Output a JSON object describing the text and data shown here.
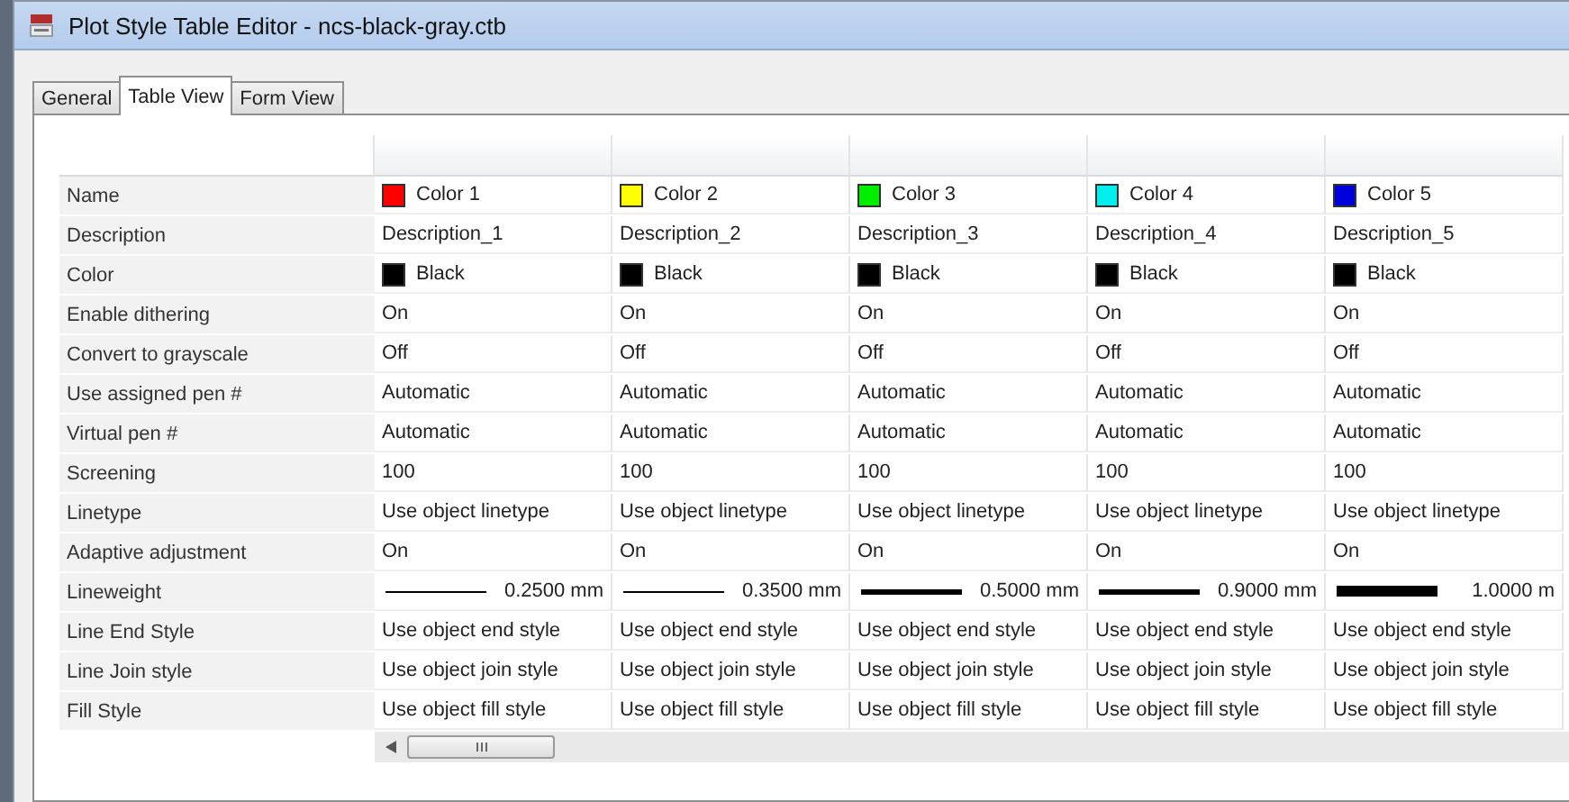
{
  "window": {
    "title": "Plot Style Table Editor - ncs-black-gray.ctb"
  },
  "tabs": [
    {
      "label": "General",
      "selected": false
    },
    {
      "label": "Table View",
      "selected": true
    },
    {
      "label": "Form View",
      "selected": false
    }
  ],
  "table": {
    "rows": [
      {
        "label": "Name",
        "cells": [
          {
            "kind": "swatch",
            "color": "#ff0000",
            "text": "Color 1"
          },
          {
            "kind": "swatch",
            "color": "#ffff00",
            "text": "Color 2"
          },
          {
            "kind": "swatch",
            "color": "#00ee00",
            "text": "Color 3"
          },
          {
            "kind": "swatch",
            "color": "#00eeee",
            "text": "Color 4"
          },
          {
            "kind": "swatch",
            "color": "#0000dd",
            "text": "Color 5"
          }
        ]
      },
      {
        "label": "Description",
        "cells": [
          {
            "kind": "text",
            "text": "Description_1"
          },
          {
            "kind": "text",
            "text": "Description_2"
          },
          {
            "kind": "text",
            "text": "Description_3"
          },
          {
            "kind": "text",
            "text": "Description_4"
          },
          {
            "kind": "text",
            "text": "Description_5"
          }
        ]
      },
      {
        "label": "Color",
        "cells": [
          {
            "kind": "swatch",
            "color": "#000000",
            "text": "Black"
          },
          {
            "kind": "swatch",
            "color": "#000000",
            "text": "Black"
          },
          {
            "kind": "swatch",
            "color": "#000000",
            "text": "Black"
          },
          {
            "kind": "swatch",
            "color": "#000000",
            "text": "Black"
          },
          {
            "kind": "swatch",
            "color": "#000000",
            "text": "Black"
          }
        ]
      },
      {
        "label": "Enable dithering",
        "cells": [
          {
            "kind": "text",
            "text": "On"
          },
          {
            "kind": "text",
            "text": "On"
          },
          {
            "kind": "text",
            "text": "On"
          },
          {
            "kind": "text",
            "text": "On"
          },
          {
            "kind": "text",
            "text": "On"
          }
        ]
      },
      {
        "label": "Convert to grayscale",
        "cells": [
          {
            "kind": "text",
            "text": "Off"
          },
          {
            "kind": "text",
            "text": "Off"
          },
          {
            "kind": "text",
            "text": "Off"
          },
          {
            "kind": "text",
            "text": "Off"
          },
          {
            "kind": "text",
            "text": "Off"
          }
        ]
      },
      {
        "label": "Use assigned pen #",
        "cells": [
          {
            "kind": "text",
            "text": "Automatic"
          },
          {
            "kind": "text",
            "text": "Automatic"
          },
          {
            "kind": "text",
            "text": "Automatic"
          },
          {
            "kind": "text",
            "text": "Automatic"
          },
          {
            "kind": "text",
            "text": "Automatic"
          }
        ]
      },
      {
        "label": "Virtual pen #",
        "cells": [
          {
            "kind": "text",
            "text": "Automatic"
          },
          {
            "kind": "text",
            "text": "Automatic"
          },
          {
            "kind": "text",
            "text": "Automatic"
          },
          {
            "kind": "text",
            "text": "Automatic"
          },
          {
            "kind": "text",
            "text": "Automatic"
          }
        ]
      },
      {
        "label": "Screening",
        "cells": [
          {
            "kind": "text",
            "text": "100"
          },
          {
            "kind": "text",
            "text": "100"
          },
          {
            "kind": "text",
            "text": "100"
          },
          {
            "kind": "text",
            "text": "100"
          },
          {
            "kind": "text",
            "text": "100"
          }
        ]
      },
      {
        "label": "Linetype",
        "cells": [
          {
            "kind": "text",
            "text": "Use object linetype"
          },
          {
            "kind": "text",
            "text": "Use object linetype"
          },
          {
            "kind": "text",
            "text": "Use object linetype"
          },
          {
            "kind": "text",
            "text": "Use object linetype"
          },
          {
            "kind": "text",
            "text": "Use object linetype"
          }
        ]
      },
      {
        "label": "Adaptive adjustment",
        "cells": [
          {
            "kind": "text",
            "text": "On"
          },
          {
            "kind": "text",
            "text": "On"
          },
          {
            "kind": "text",
            "text": "On"
          },
          {
            "kind": "text",
            "text": "On"
          },
          {
            "kind": "text",
            "text": "On"
          }
        ]
      },
      {
        "label": "Lineweight",
        "cells": [
          {
            "kind": "thinline",
            "text": "0.2500 mm"
          },
          {
            "kind": "thinline",
            "text": "0.3500 mm"
          },
          {
            "kind": "boldline",
            "text": "0.5000 mm"
          },
          {
            "kind": "boldline",
            "text": "0.9000 mm"
          },
          {
            "kind": "heavyline",
            "text": "1.0000 m"
          }
        ]
      },
      {
        "label": "Line End Style",
        "cells": [
          {
            "kind": "text",
            "text": "Use object end style"
          },
          {
            "kind": "text",
            "text": "Use object end style"
          },
          {
            "kind": "text",
            "text": "Use object end style"
          },
          {
            "kind": "text",
            "text": "Use object end style"
          },
          {
            "kind": "text",
            "text": "Use object end style"
          }
        ]
      },
      {
        "label": "Line Join style",
        "cells": [
          {
            "kind": "text",
            "text": "Use object join style"
          },
          {
            "kind": "text",
            "text": "Use object join style"
          },
          {
            "kind": "text",
            "text": "Use object join style"
          },
          {
            "kind": "text",
            "text": "Use object join style"
          },
          {
            "kind": "text",
            "text": "Use object join style"
          }
        ]
      },
      {
        "label": "Fill Style",
        "cells": [
          {
            "kind": "text",
            "text": "Use object fill style"
          },
          {
            "kind": "text",
            "text": "Use object fill style"
          },
          {
            "kind": "text",
            "text": "Use object fill style"
          },
          {
            "kind": "text",
            "text": "Use object fill style"
          },
          {
            "kind": "text",
            "text": "Use object fill style"
          }
        ]
      }
    ]
  }
}
